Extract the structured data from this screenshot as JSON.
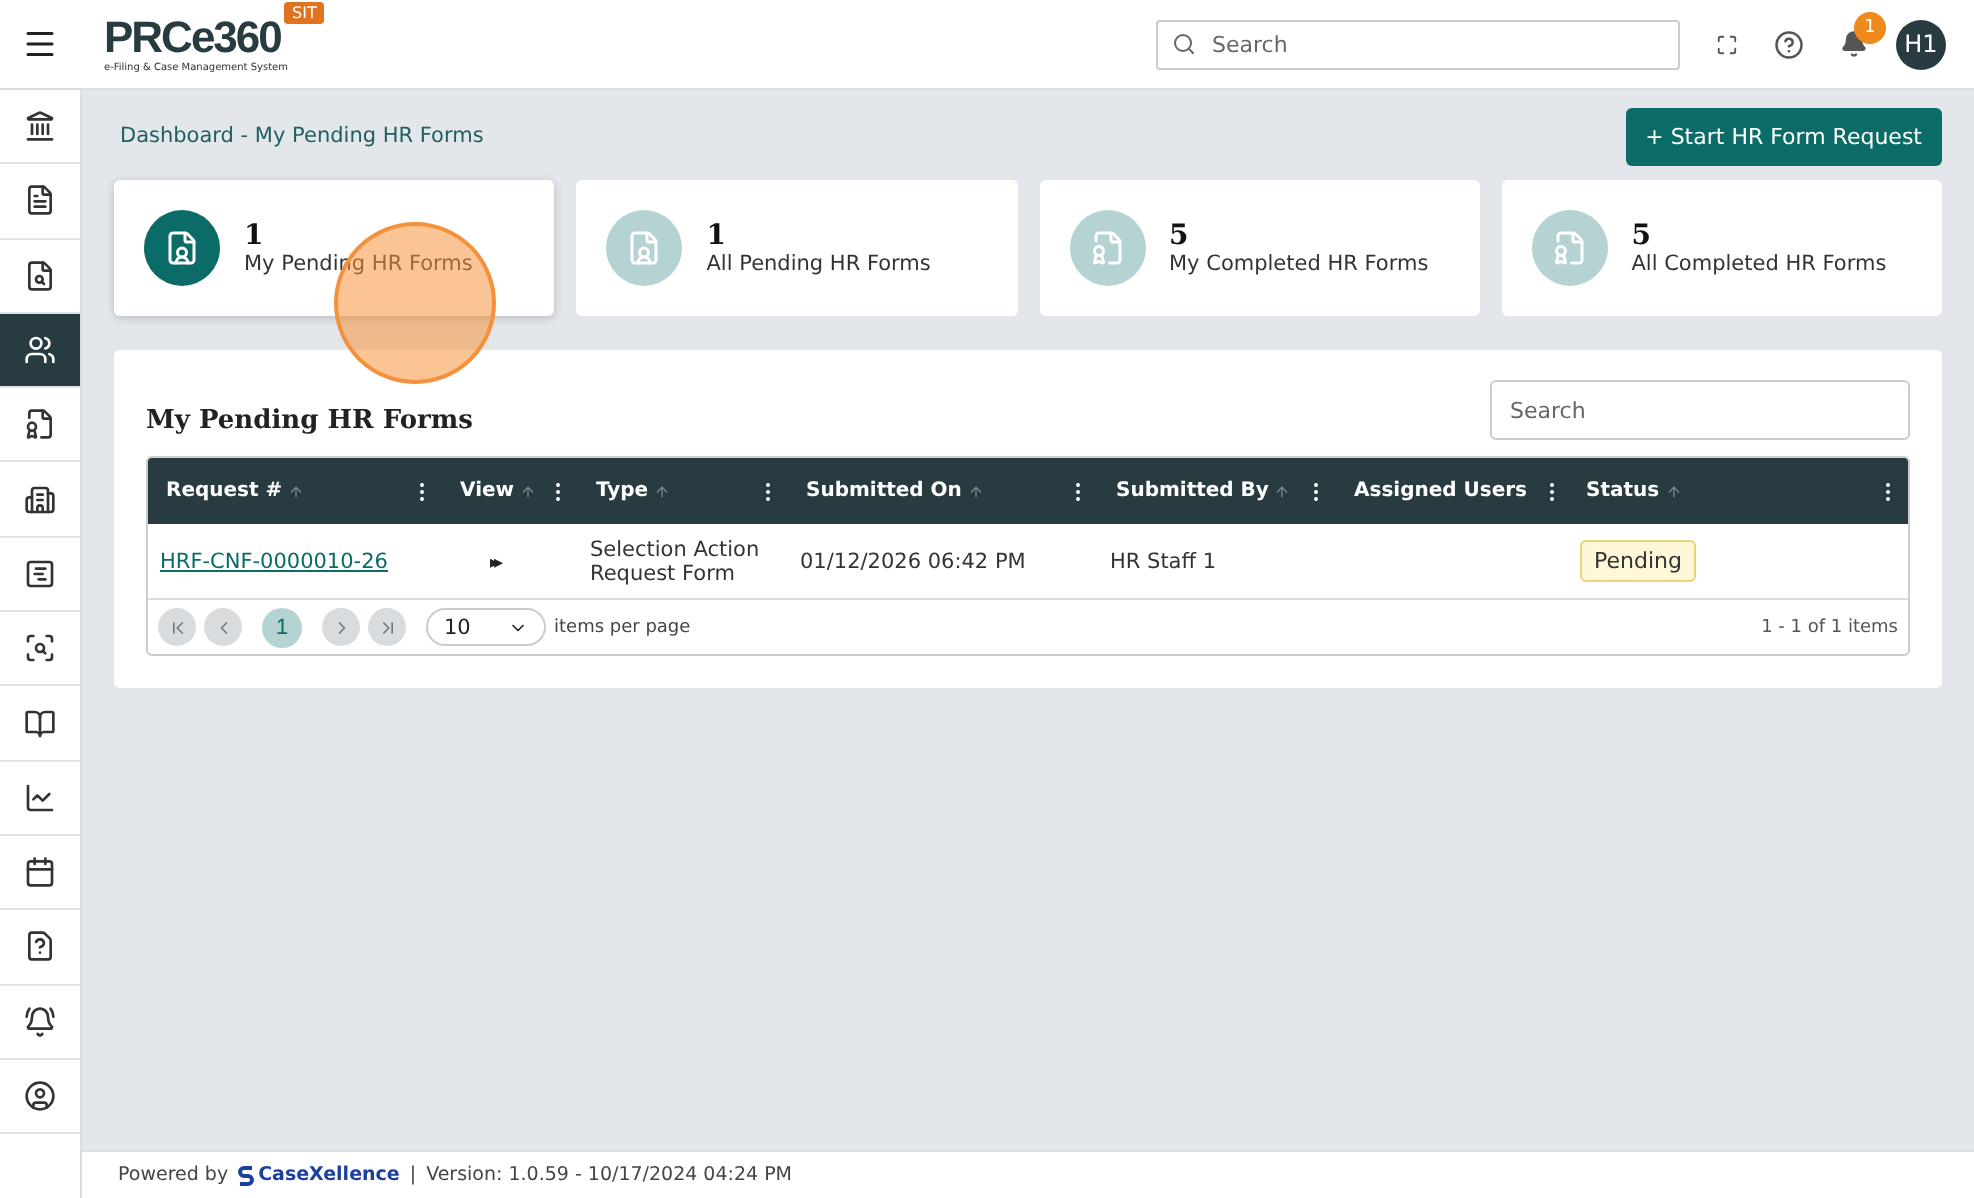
{
  "header": {
    "logo": "PRCe360",
    "logo_subtitle": "e-Filing & Case Management System",
    "env_badge": "SIT",
    "search": {
      "placeholder": "Search"
    },
    "notifications": "1",
    "avatar": "H1"
  },
  "sidebar": {
    "items": [
      {
        "selected": false
      },
      {
        "selected": false
      },
      {
        "selected": false
      },
      {
        "selected": true
      },
      {
        "selected": false
      },
      {
        "selected": false
      },
      {
        "selected": false
      },
      {
        "selected": false
      },
      {
        "selected": false
      },
      {
        "selected": false
      },
      {
        "selected": false
      },
      {
        "selected": false
      },
      {
        "selected": false
      },
      {
        "selected": false
      }
    ]
  },
  "breadcrumb": "Dashboard - My Pending HR Forms",
  "start_button": "+ Start HR Form Request",
  "cards": [
    {
      "count": "1",
      "label": "My Pending HR Forms",
      "selected": true
    },
    {
      "count": "1",
      "label": "All Pending HR Forms",
      "selected": false
    },
    {
      "count": "5",
      "label": "My Completed HR Forms",
      "selected": false
    },
    {
      "count": "5",
      "label": "All Completed HR Forms",
      "selected": false
    }
  ],
  "table": {
    "title": "My Pending HR Forms",
    "search": {
      "placeholder": "Search"
    },
    "columns": [
      "Request #",
      "View",
      "Type",
      "Submitted On",
      "Submitted By",
      "Assigned Users",
      "Status"
    ],
    "rows": [
      {
        "request": "HRF-CNF-0000010-26",
        "view": "▸▸",
        "type": "Selection Action Request Form",
        "submitted_on": "01/12/2026 06:42 PM",
        "submitted_by": "HR Staff 1",
        "assigned_users": "",
        "status": "Pending"
      }
    ],
    "pager": {
      "pages": [
        {
          "label": "1",
          "selected": true
        }
      ],
      "page_size": "10",
      "page_size_label": "items per page",
      "summary": "1 - 1 of 1 items"
    }
  },
  "footer": {
    "powered_by": "Powered by",
    "brand": "CaseXellence",
    "separator": "|",
    "version": "Version: 1.0.59 - 10/17/2024 04:24 PM"
  }
}
